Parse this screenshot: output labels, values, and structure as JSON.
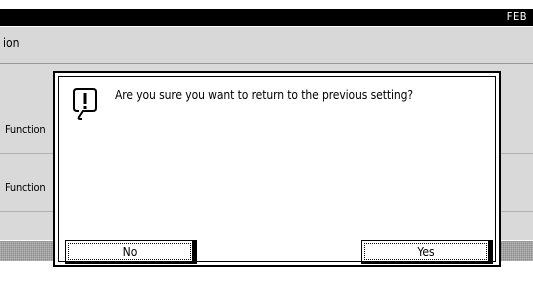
{
  "header": {
    "right_text": "FEB"
  },
  "background": {
    "title": "ion",
    "labels": [
      "Function",
      "Function"
    ]
  },
  "dialog": {
    "icon": "alert-icon",
    "message": "Are you sure you want to return to the previous setting?",
    "buttons": {
      "no": "No",
      "yes": "Yes"
    }
  }
}
